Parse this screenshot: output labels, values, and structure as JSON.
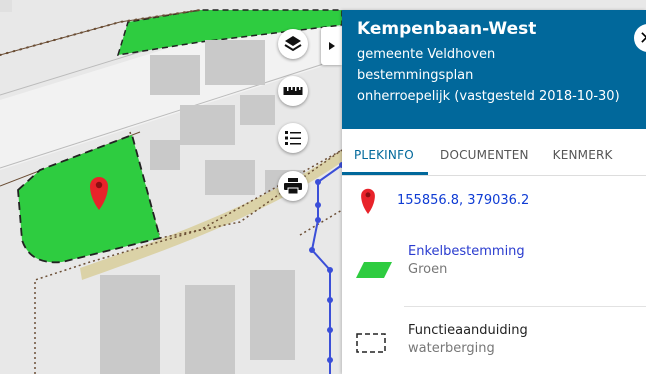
{
  "panel": {
    "title": "Kempenbaan-West",
    "municipality": "gemeente Veldhoven",
    "plan_type": "bestemmingsplan",
    "status": "onherroepelijk (vastgesteld 2018-10-30)",
    "close_icon": "close-icon"
  },
  "tabs": [
    {
      "label": "PLEKINFO",
      "active": true
    },
    {
      "label": "DOCUMENTEN",
      "active": false
    },
    {
      "label": "KENMERK",
      "active": false
    }
  ],
  "location": {
    "coordinates": "155856.8, 379036.2",
    "icon": "location-pin-icon",
    "color": "#e8232a"
  },
  "legend": [
    {
      "title": "Enkelbestemming",
      "subtitle": "Groen",
      "icon": "green-parallelogram-icon",
      "color": "#2ecc40"
    },
    {
      "title": "Functieaanduiding",
      "subtitle": "waterberging",
      "icon": "dashed-box-icon"
    }
  ],
  "map_tools": [
    {
      "name": "layers-icon"
    },
    {
      "name": "ruler-icon"
    },
    {
      "name": "legend-list-icon"
    },
    {
      "name": "print-icon"
    }
  ],
  "colors": {
    "header_bg": "#01689b",
    "green_zone": "#2ecc40",
    "blue_line": "#3b4fd8",
    "road": "#d9cfa0"
  }
}
